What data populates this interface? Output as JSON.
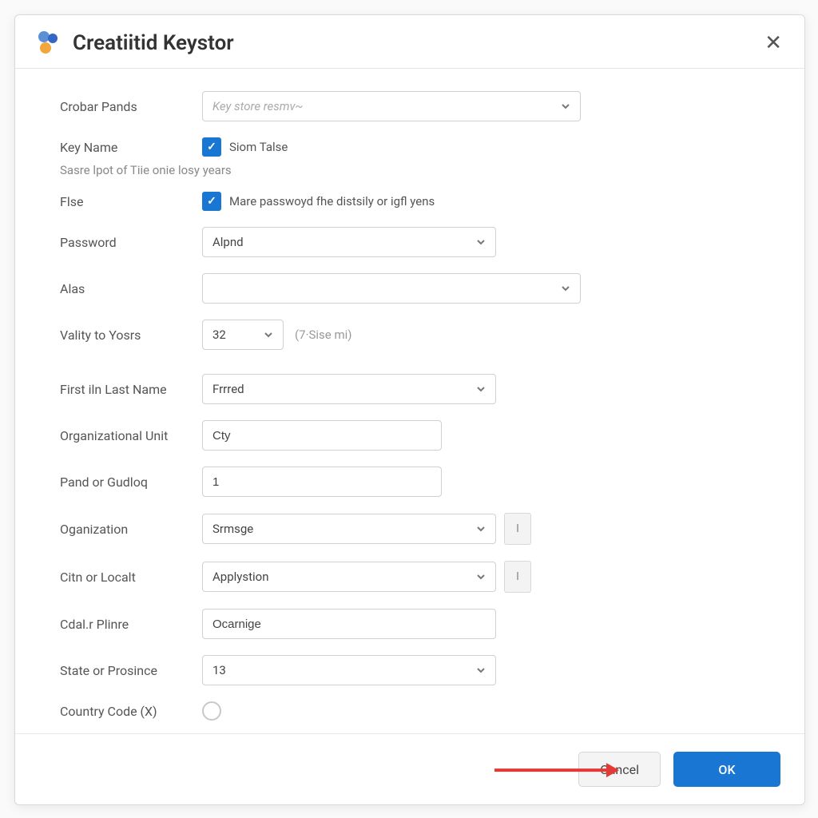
{
  "window": {
    "title": "Creatiitid Keystor"
  },
  "form": {
    "store_path": {
      "label": "Crobar Pands",
      "placeholder": "Key store resmv~"
    },
    "key_name": {
      "label": "Key Name",
      "checkbox_label": "Siom Talse",
      "checked": true
    },
    "sub_hint": "Sasre lpot of Tiie onie losy years",
    "flse": {
      "label": "Flse",
      "checkbox_label": "Mare passwoyd fhe distsily or igfl yens",
      "checked": true
    },
    "password": {
      "label": "Password",
      "value": "Alpnd"
    },
    "alias": {
      "label": "Alas",
      "value": ""
    },
    "validity": {
      "label": "Vality to Yosrs",
      "value": "32",
      "hint": "(7·Sise mi)"
    },
    "first_last": {
      "label": "First iln Last Name",
      "value": "Frrred"
    },
    "org_unit": {
      "label": "Organizational Unit",
      "value": "Cty"
    },
    "pand": {
      "label": "Pand or Gudloq",
      "value": "1"
    },
    "organization": {
      "label": "Oganization",
      "value": "Srmsge",
      "aux": "I"
    },
    "city": {
      "label": "Citn or Localt",
      "value": "Applystion",
      "aux": "I"
    },
    "cdalr": {
      "label": "Cdal.r Plinre",
      "value": "Ocarnige"
    },
    "state": {
      "label": "State or Prosince",
      "value": "13"
    },
    "country": {
      "label": "Country Code (X)"
    }
  },
  "footer": {
    "cancel": "Cancel",
    "ok": "OK"
  }
}
